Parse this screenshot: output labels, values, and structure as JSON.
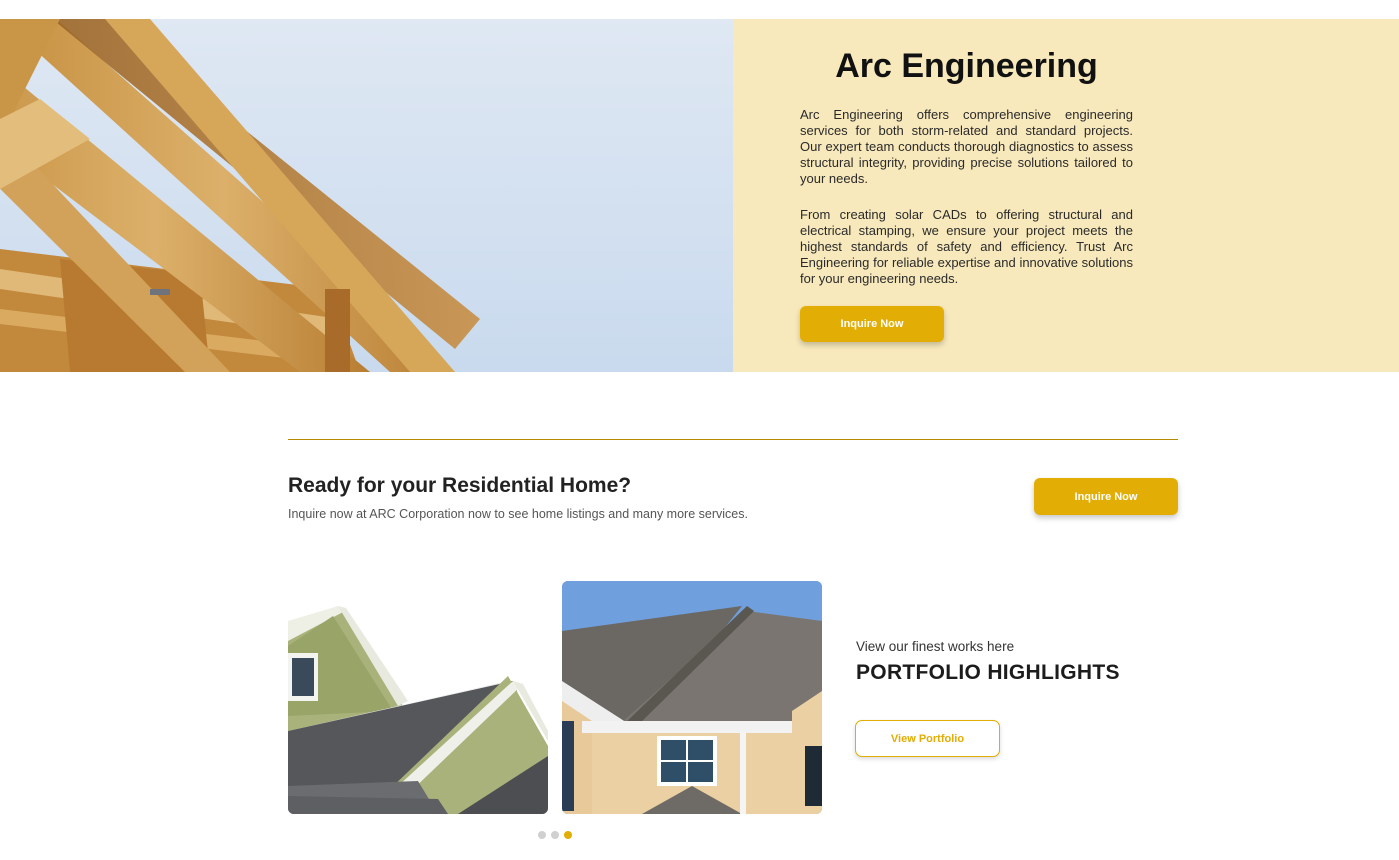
{
  "hero": {
    "title": "Arc Engineering",
    "paragraph1": "Arc Engineering offers comprehensive engineering services for both storm-related and standard projects. Our expert team conducts thorough diagnostics to assess structural integrity, providing precise solutions tailored to your needs.",
    "paragraph2": "From creating solar CADs to offering structural and electrical stamping, we ensure your project meets the highest standards of safety and efficiency. Trust Arc Engineering for reliable expertise and innovative solutions for your engineering needs.",
    "button_label": "Inquire Now"
  },
  "cta": {
    "title": "Ready for your Residential Home?",
    "subtitle": "Inquire now at ARC Corporation now to see home listings and many more services.",
    "button_label": "Inquire Now"
  },
  "portfolio": {
    "subtitle": "View our finest works here",
    "title": "PORTFOLIO HIGHLIGHTS",
    "button_label": "View Portfolio",
    "carousel_active_index": 2,
    "carousel_count": 3
  },
  "colors": {
    "accent": "#e2ad04",
    "hero_panel": "#f8e9bc",
    "divider": "#b58a00"
  }
}
